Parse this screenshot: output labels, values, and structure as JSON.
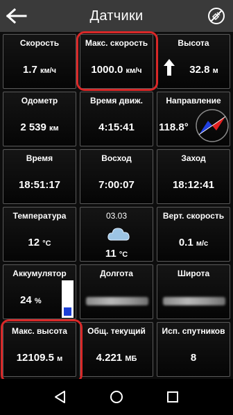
{
  "header": {
    "title": "Датчики",
    "back_icon": "arrow-left-icon",
    "satellite_icon": "satellite-icon"
  },
  "tiles": {
    "speed": {
      "label": "Скорость",
      "value": "1.7",
      "unit": "км/ч"
    },
    "max_speed": {
      "label": "Макс. скорость",
      "value": "1000.0",
      "unit": "км/ч"
    },
    "altitude": {
      "label": "Высота",
      "value": "32.8",
      "unit": "м"
    },
    "odometer": {
      "label": "Одометр",
      "value": "2 539",
      "unit": "км"
    },
    "moving_time": {
      "label": "Время движ.",
      "value": "4:15:41"
    },
    "direction": {
      "label": "Направление",
      "value": "118.8°"
    },
    "time": {
      "label": "Время",
      "value": "18:51:17"
    },
    "sunrise": {
      "label": "Восход",
      "value": "7:00:07"
    },
    "sunset": {
      "label": "Заход",
      "value": "18:12:41"
    },
    "temperature": {
      "label": "Температура",
      "value": "12",
      "unit": "°C"
    },
    "weather": {
      "label": "03.03",
      "value": "11",
      "unit": "°C"
    },
    "vert_speed": {
      "label": "Верт. скорость",
      "value": "0.1",
      "unit": "м/с"
    },
    "battery": {
      "label": "Аккумулятор",
      "value": "24",
      "unit": "%",
      "level": 0.24
    },
    "longitude": {
      "label": "Долгота"
    },
    "latitude": {
      "label": "Широта"
    },
    "max_altitude": {
      "label": "Макс. высота",
      "value": "12109.5",
      "unit": "м"
    },
    "traffic": {
      "label": "Общ. текущий",
      "value": "4.221",
      "unit": "МБ"
    },
    "satellites": {
      "label": "Исп. спутников",
      "value": "8"
    }
  },
  "colors": {
    "highlight": "#d92828",
    "battery_fill": "#1c3fd6",
    "compass_red": "#e02020",
    "compass_blue": "#2040e0"
  },
  "nav": {
    "back_icon": "triangle-back-icon",
    "home_icon": "circle-home-icon",
    "recents_icon": "square-recents-icon"
  }
}
